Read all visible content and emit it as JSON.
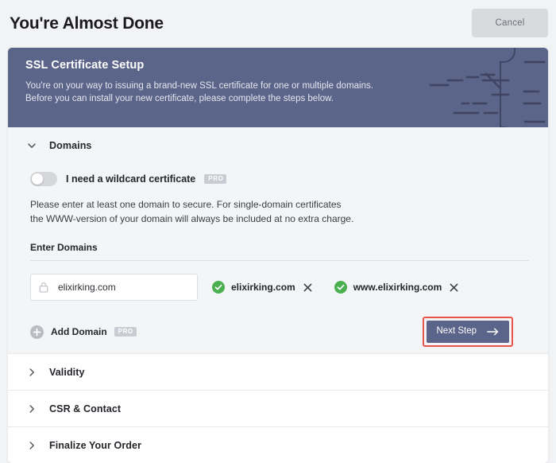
{
  "page": {
    "title": "You're Almost Done",
    "cancel_label": "Cancel"
  },
  "banner": {
    "heading": "SSL Certificate Setup",
    "line1": "You're on your way to issuing a brand-new SSL certificate for one or multiple domains.",
    "line2": "Before you can install your new certificate, please complete the steps below.",
    "background_color": "#5b6489"
  },
  "domains": {
    "section_title": "Domains",
    "chevron_icon": "chevron-down-icon",
    "wildcard": {
      "label": "I need a wildcard certificate",
      "badge": "PRO",
      "enabled": false
    },
    "helper_line1": "Please enter at least one domain to secure. For single-domain certificates",
    "helper_line2": "the WWW-version of your domain will always be included at no extra charge.",
    "enter_domains_label": "Enter Domains",
    "input": {
      "value": "elixirking.com",
      "placeholder": "elixirking.com",
      "icon": "lock-icon"
    },
    "chips": [
      {
        "label": "elixirking.com",
        "status_icon": "check-circle-icon",
        "remove_icon": "close-icon"
      },
      {
        "label": "www.elixirking.com",
        "status_icon": "check-circle-icon",
        "remove_icon": "close-icon"
      }
    ],
    "add_domain": {
      "label": "Add Domain",
      "badge": "PRO",
      "icon": "plus-circle-icon"
    },
    "next_step": {
      "label": "Next Step",
      "icon": "arrow-right-icon",
      "highlight_color": "#e8534a",
      "button_color": "#5b6489"
    }
  },
  "sections": [
    {
      "title": "Validity",
      "chevron_icon": "chevron-right-icon"
    },
    {
      "title": "CSR & Contact",
      "chevron_icon": "chevron-right-icon"
    },
    {
      "title": "Finalize Your Order",
      "chevron_icon": "chevron-right-icon"
    }
  ],
  "colors": {
    "page_background": "#f2f3f5",
    "panel_background": "#f4f5f7",
    "accent": "#5b6489",
    "success": "#4caf50",
    "danger": "#e8534a"
  }
}
